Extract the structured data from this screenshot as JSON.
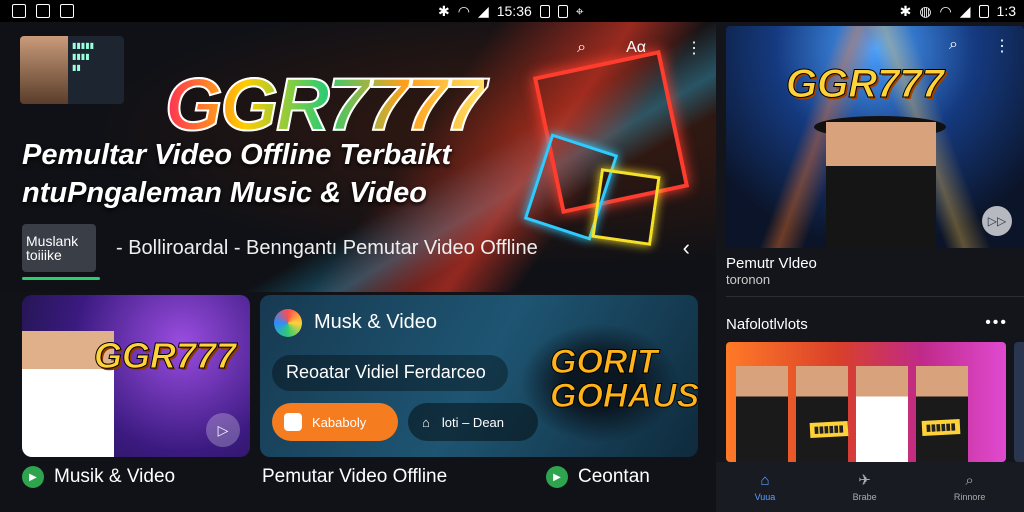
{
  "status_bar": {
    "time_left": "15:36",
    "time_right": "1:3"
  },
  "hero": {
    "logo": "GGR7777",
    "tagline": "",
    "title_line1": "Pemultar Video Offline Terbaikt",
    "title_line2": "ntuPngaleman Music & Video",
    "menu_label": "Aα",
    "sub_thumb_label": "Muslank\ntoiiike",
    "sub_text": "- Bolliroardal - Benngantı Pemutar Video Offline"
  },
  "card1": {
    "logo": "GGR777"
  },
  "card2": {
    "title": "Musk & Video",
    "pill": "Reoatar Vidiel Ferdarceo",
    "btn_primary": "Kababoly",
    "btn_secondary": "loti – Dean",
    "logo": "GORIT GOHAUS"
  },
  "bottom_labels": [
    {
      "label": "Musik & Video"
    },
    {
      "label": "Pemutar Video Offline"
    },
    {
      "label": "Ceontan"
    }
  ],
  "right": {
    "logo": "GGR777",
    "caption_title": "Pemutr Vldeo",
    "caption_sub": "toronon",
    "section_title": "Nafolotlvlots",
    "nav": [
      {
        "label": "Vuua",
        "icon": "home-icon"
      },
      {
        "label": "Brabe",
        "icon": "share-icon"
      },
      {
        "label": "Rinnore",
        "icon": "search-icon"
      }
    ]
  },
  "colors": {
    "accent_green": "#2ecc71",
    "accent_orange": "#f57c1f",
    "nav_active": "#5aa0ff"
  }
}
